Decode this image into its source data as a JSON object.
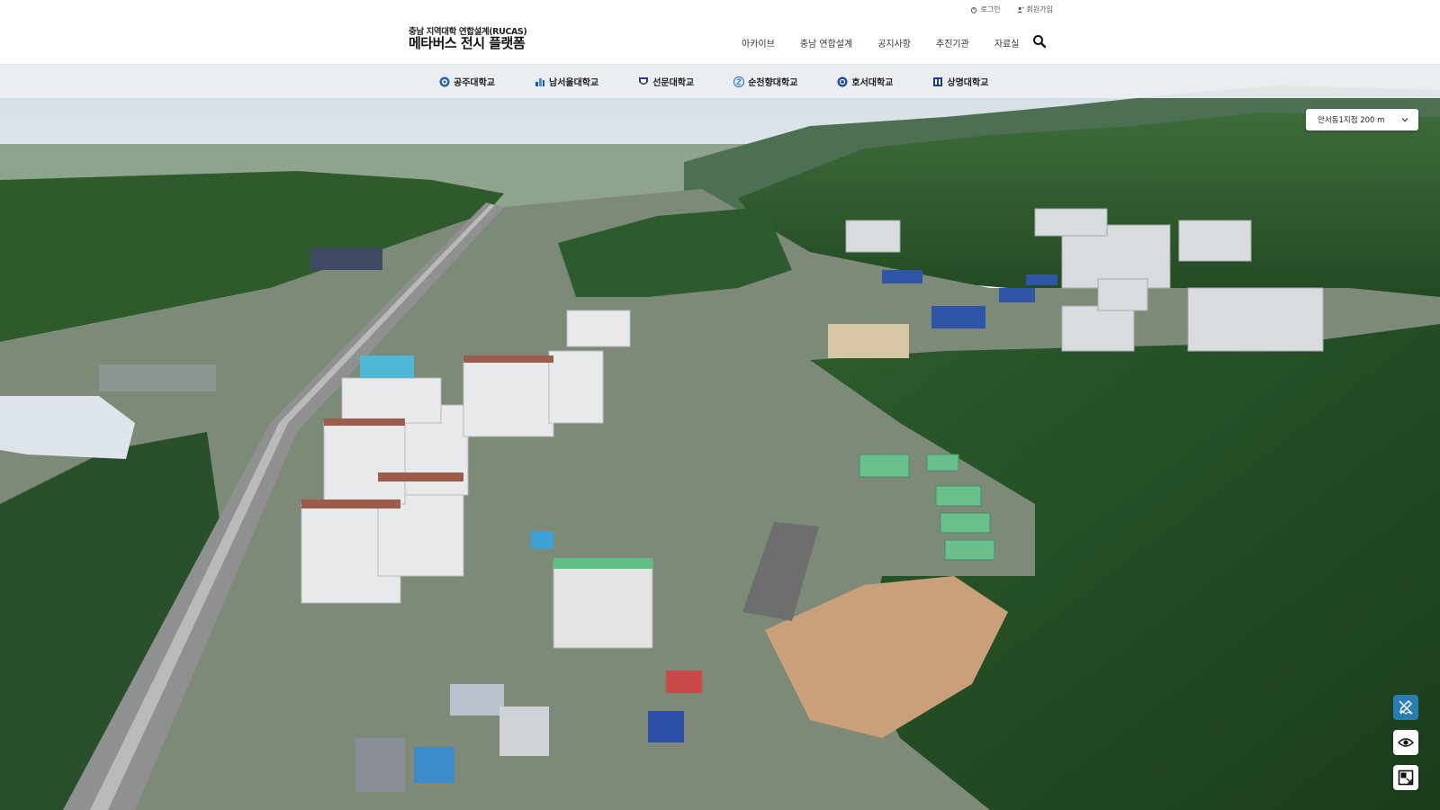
{
  "header": {
    "util": {
      "login": "로그인",
      "signup": "회원가입"
    },
    "logo": {
      "sub": "충남 지역대학 연합설계(RUCAS)",
      "main": "메타버스 전시 플랫폼"
    },
    "nav": [
      {
        "label": "아카이브"
      },
      {
        "label": "충남 연합설계"
      },
      {
        "label": "공지사항"
      },
      {
        "label": "추진기관"
      },
      {
        "label": "자료실"
      }
    ]
  },
  "universities": [
    {
      "label": "공주대학교",
      "color": "#2b5fa6"
    },
    {
      "label": "남서울대학교",
      "color": "#1f5aa8"
    },
    {
      "label": "선문대학교",
      "color": "#2f3f6b"
    },
    {
      "label": "순천향대학교",
      "color": "#3a78c4"
    },
    {
      "label": "호서대학교",
      "color": "#1d4c98"
    },
    {
      "label": "상명대학교",
      "color": "#1b3f8c"
    }
  ],
  "location": {
    "selected": "안서동1지점 200 m"
  },
  "colors": {
    "accent": "#2a7db3",
    "forest": "#2f5a2a",
    "sky": "#d9e2ea"
  }
}
